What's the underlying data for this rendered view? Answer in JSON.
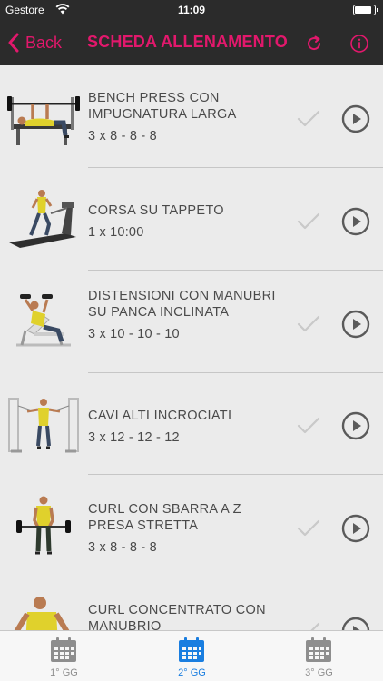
{
  "status_bar": {
    "carrier": "Gestore",
    "time": "11:09",
    "icons": [
      "wifi-icon",
      "battery-icon"
    ]
  },
  "nav": {
    "back_label": "Back",
    "title": "SCHEDA ALLENAMENTO",
    "icons": [
      "chevron-left-icon",
      "refresh-icon",
      "info-icon"
    ]
  },
  "colors": {
    "accent": "#e2186c",
    "bar_bg": "#2b2b2b",
    "list_bg": "#ebebeb",
    "tab_active": "#1a7ee0",
    "tab_inactive": "#8e8e8e",
    "icon_gray": "#5a5a5a",
    "check_gray": "#c9c9c9"
  },
  "exercises": [
    {
      "name": "BENCH PRESS CON IMPUGNATURA LARGA",
      "sets": "3 x 8 - 8 - 8",
      "illustration": "bench-press-illustration"
    },
    {
      "name": "CORSA SU TAPPETO",
      "sets": "1 x 10:00",
      "illustration": "treadmill-illustration"
    },
    {
      "name": "DISTENSIONI CON MANUBRI SU PANCA INCLINATA",
      "sets": "3 x 10 - 10 - 10",
      "illustration": "incline-dumbbell-press-illustration"
    },
    {
      "name": "CAVI ALTI INCROCIATI",
      "sets": "3 x 12 - 12 - 12",
      "illustration": "cable-crossover-illustration"
    },
    {
      "name": "CURL CON SBARRA A Z PRESA STRETTA",
      "sets": "3 x 8 - 8 - 8",
      "illustration": "ez-bar-curl-illustration"
    },
    {
      "name": "CURL CONCENTRATO CON MANUBRIO",
      "sets": "",
      "illustration": "concentration-curl-illustration"
    }
  ],
  "tabs": [
    {
      "label": "1° GG",
      "icon": "calendar-icon",
      "active": false
    },
    {
      "label": "2° GG",
      "icon": "calendar-icon",
      "active": true
    },
    {
      "label": "3° GG",
      "icon": "calendar-icon",
      "active": false
    }
  ]
}
